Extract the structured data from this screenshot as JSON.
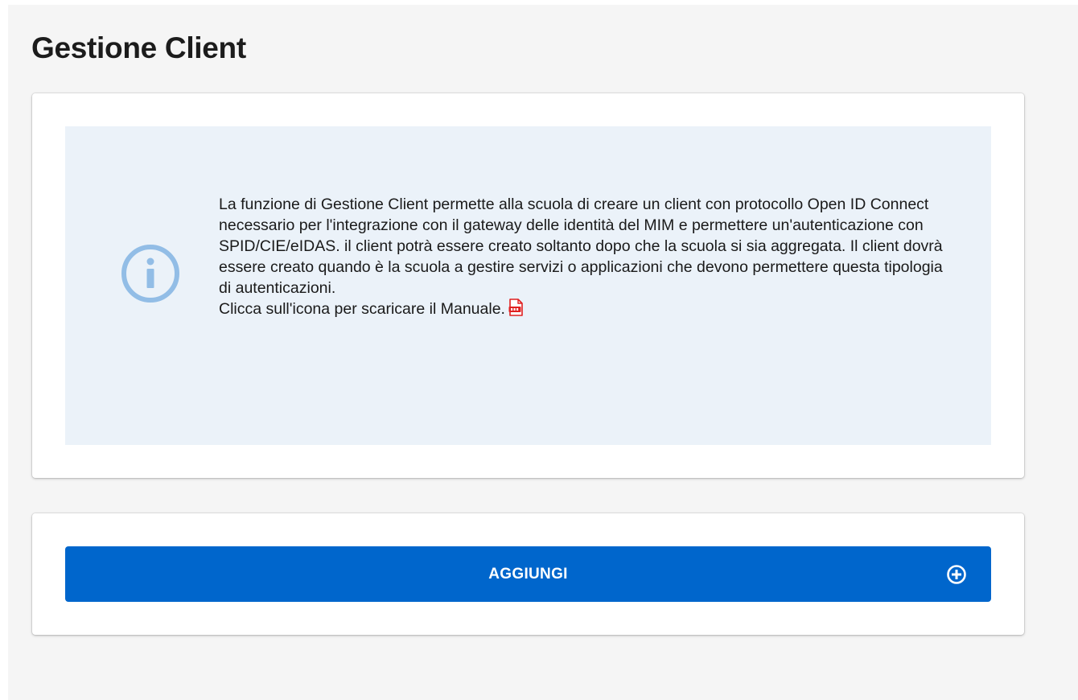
{
  "page": {
    "title": "Gestione Client"
  },
  "info": {
    "icon": "info-circle-icon",
    "paragraph": "La funzione di Gestione Client permette alla scuola di creare un client con protocollo Open ID Connect necessario per l'integrazione con il gateway delle identità del MIM e permettere un'autenticazione con SPID/CIE/eIDAS. il client potrà essere creato soltanto dopo che la scuola si sia aggregata. Il client dovrà essere creato quando è la scuola a gestire servizi o applicazioni che devono permettere questa tipologia di autenticazioni.",
    "manual_text": "Clicca sull'icona per scaricare il Manuale.",
    "manual_icon": "pdf-file-icon"
  },
  "actions": {
    "add_label": "AGGIUNGI",
    "add_icon": "plus-circle-icon"
  },
  "colors": {
    "primary": "#0066cc",
    "info_background": "#ebf2f9",
    "info_icon": "#92bde6",
    "pdf_icon": "#e02020"
  }
}
